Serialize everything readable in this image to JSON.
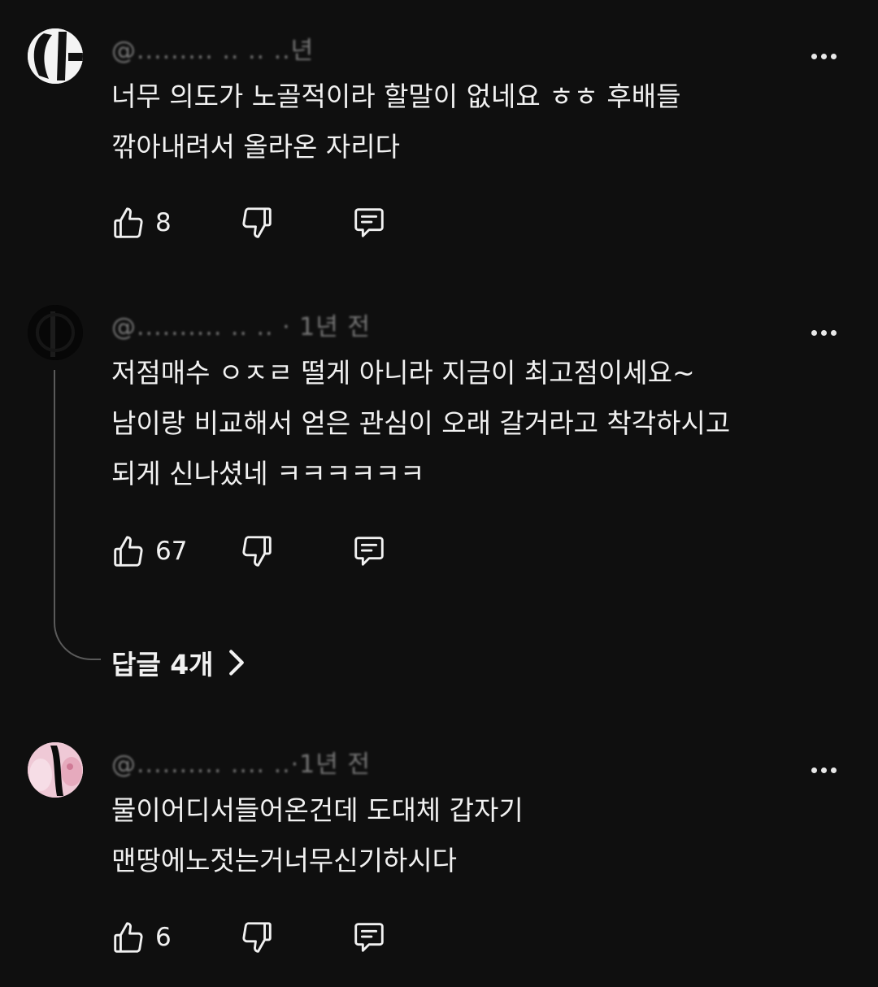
{
  "comments": [
    {
      "author": "@.........  ..  ..  ..년",
      "lines": [
        "너무 의도가 노골적이라 할말이 없네요 ㅎㅎ 후배들",
        "깎아내려서 올라온 자리다"
      ],
      "likes": "8"
    },
    {
      "author": "@..........  .. .. · 1년 전",
      "lines": [
        "저점매수 ㅇㅈㄹ 떨게 아니라 지금이 최고점이세요~",
        "남이랑 비교해서 얻은 관심이 오래 갈거라고 착각하시고",
        "되게 신나셨네 ㅋㅋㅋㅋㅋㅋ"
      ],
      "likes": "67",
      "replies_label": "답글 4개"
    },
    {
      "author": "@..........  ....  ..·1년 전",
      "lines": [
        "물이어디서들어온건데 도대체 갑자기",
        "맨땅에노젓는거너무신기하시다"
      ],
      "likes": "6"
    }
  ],
  "icons": [
    "thumb-up-icon",
    "thumb-down-icon",
    "reply-icon",
    "more-vert-icon",
    "chevron-right-icon"
  ],
  "colors": {
    "background": "#0f0f0f",
    "text": "#f1f1f1",
    "meta": "#9a9a9a"
  }
}
